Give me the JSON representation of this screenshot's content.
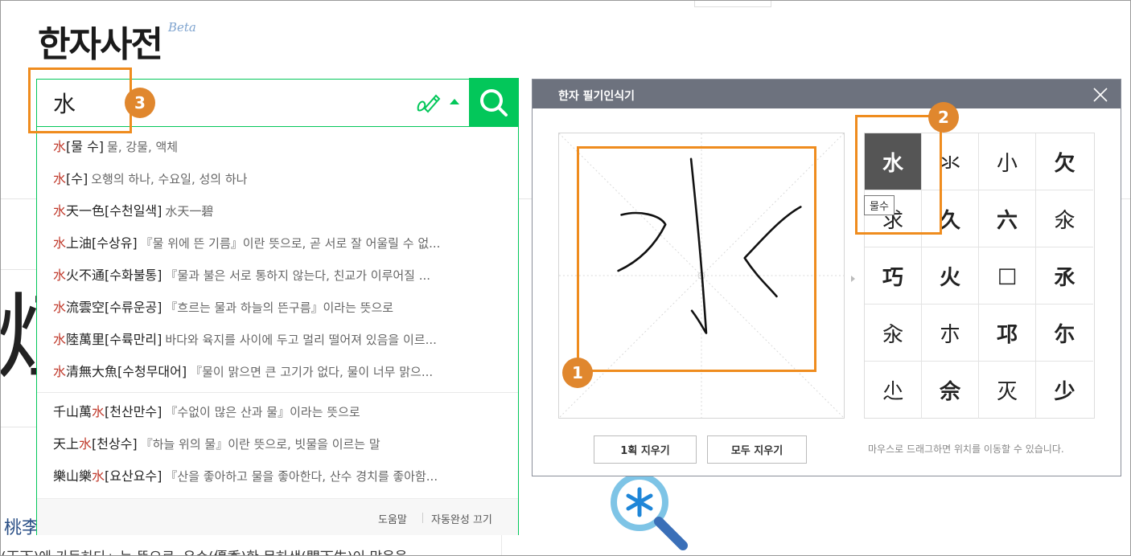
{
  "logo": {
    "title": "한자사전",
    "badge": "Beta"
  },
  "search": {
    "value": "水",
    "button_label": "search"
  },
  "suggestions_primary": [
    {
      "hl": "水",
      "rest": "[물 수]",
      "desc": "물, 강물, 액체"
    },
    {
      "hl": "水",
      "rest": "[수]",
      "desc": "오행의 하나, 수요일, 성의 하나"
    },
    {
      "hl": "水",
      "rest": "天一色[수천일색]",
      "desc": "水天一碧"
    },
    {
      "hl": "水",
      "rest": "上油[수상유]",
      "desc": "『물 위에 뜬 기름』이란 뜻으로, 곧 서로 잘 어울릴 수 없..."
    },
    {
      "hl": "水",
      "rest": "火不通[수화불통]",
      "desc": "『물과 불은 서로 통하지 않는다, 친교가 이루어질 ..."
    },
    {
      "hl": "水",
      "rest": "流雲空[수류운공]",
      "desc": "『흐르는 물과 하늘의 뜬구름』이라는 뜻으로"
    },
    {
      "hl": "水",
      "rest": "陸萬里[수륙만리]",
      "desc": "바다와 육지를 사이에 두고 멀리 떨어져 있음을 이르..."
    },
    {
      "hl": "水",
      "rest": "清無大魚[수청무대어]",
      "desc": "『물이 맑으면 큰 고기가 없다, 물이 너무 맑으..."
    }
  ],
  "suggestions_secondary": [
    {
      "pre": "千山萬",
      "hl": "水",
      "rest": "[천산만수]",
      "desc": "『수없이 많은 산과 물』이라는 뜻으로"
    },
    {
      "pre": "天上",
      "hl": "水",
      "rest": "[천상수]",
      "desc": "『하늘 위의 물』이란 뜻으로, 빗물을 이르는 말"
    },
    {
      "pre": "樂山樂",
      "hl": "水",
      "rest": "[요산요수]",
      "desc": "『산을 좋아하고 물을 좋아한다, 산수 경치를 좋아함..."
    }
  ],
  "dropdown_footer": {
    "help": "도움말",
    "autocomplete_off": "자동완성 끄기"
  },
  "handwriting": {
    "title": "한자 필기인식기",
    "tooltip": "물수",
    "candidates": [
      "水",
      "氺",
      "小",
      "欠",
      "求",
      "久",
      "六",
      "氽",
      "巧",
      "火",
      "□",
      "氶",
      "汆",
      "朩",
      "邛",
      "尓",
      "尐",
      "佘",
      "灭",
      "少"
    ],
    "bold_indices": [
      0,
      3,
      5,
      6,
      8,
      9,
      11,
      14,
      15,
      17,
      19
    ],
    "clear_one_label": "1획 지우기",
    "clear_all_label": "모두 지우기",
    "hint": "마우스로 드래그하면 위치를 이동할 수 있습니다."
  },
  "annotations": [
    "1",
    "2",
    "3"
  ],
  "background": {
    "big_char": "炡",
    "peach": "桃李",
    "bottom_text": "(天下)에 가득하다」는 뜻으로, 우수(優秀)한 문하생(門下生)이 많음을"
  },
  "colors": {
    "naver_green": "#03c75a",
    "highlight_red": "#c0392b",
    "annotation_orange": "#ef8c1e",
    "title_bar": "#6d727e"
  }
}
